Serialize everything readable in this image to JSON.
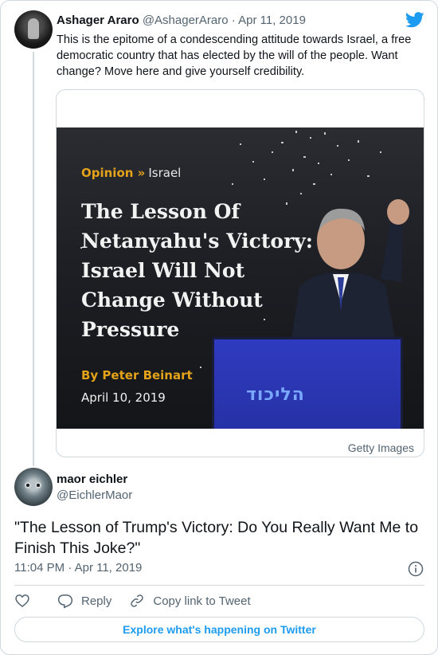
{
  "parent_tweet": {
    "author_name": "Ashager Araro",
    "handle": "@AshagerAraro",
    "separator": "·",
    "date": "Apr 11, 2019",
    "text": "This is the epitome of a condescending attitude towards Israel, a free democratic country that has elected by the will of the people. Want change? Move here and give yourself credibility.",
    "brand_icon": "twitter-bird-icon"
  },
  "media": {
    "section": "Opinion »",
    "category": "Israel",
    "headline": "The Lesson Of Netanyahu's Victory: Israel Will Not Change Without Pressure",
    "byline": "By Peter Beinart",
    "date": "April 10, 2019",
    "podium_text": "הליכוד",
    "credit": "Getty Images"
  },
  "reply_tweet": {
    "author_name": "maor eichler",
    "handle": "@EichlerMaor",
    "text": "\"The Lesson of Trump's Victory: Do You Really Want Me to Finish This Joke?\"",
    "timestamp": "11:04 PM · Apr 11, 2019"
  },
  "actions": {
    "reply_label": "Reply",
    "copy_label": "Copy link to Tweet"
  },
  "footer": {
    "explore_label": "Explore what's happening on Twitter"
  },
  "colors": {
    "accent": "#1d9bf0",
    "text_secondary": "#536471",
    "border": "#cfd9de",
    "headline_gold": "#e3a21a"
  }
}
